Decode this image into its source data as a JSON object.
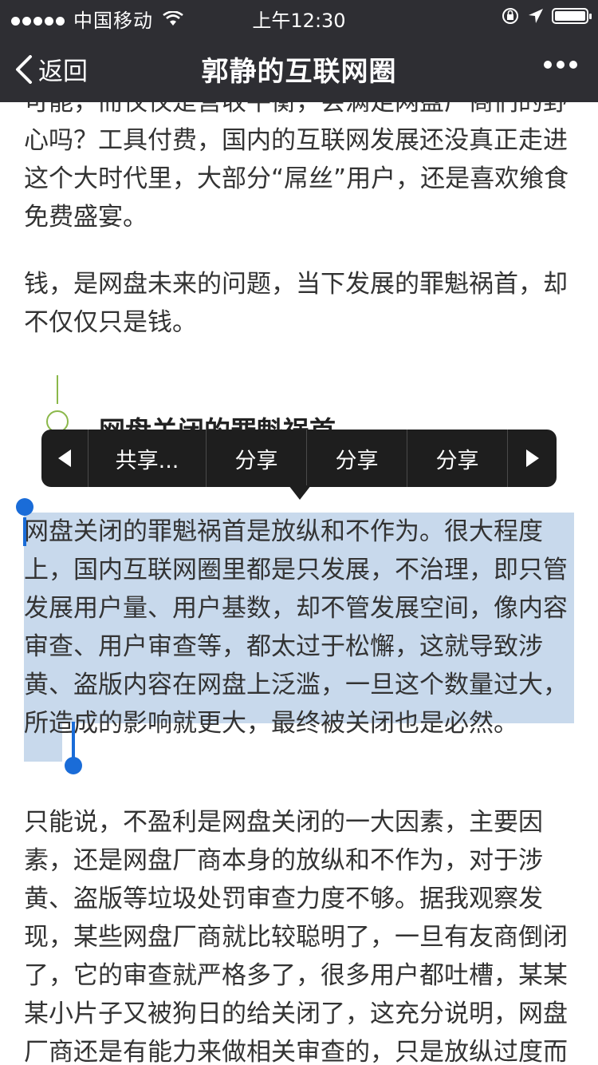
{
  "status_bar": {
    "carrier": "中国移动",
    "time": "上午12:30",
    "icons": [
      "signal-dots-icon",
      "wifi-icon",
      "rotation-lock-icon",
      "location-arrow-icon",
      "battery-icon"
    ]
  },
  "nav": {
    "back_label": "返回",
    "title": "郭静的互联网圈",
    "more_icon": "more-dots-icon"
  },
  "article": {
    "clipped_top": "可能，而仅仅是营收平衡，会满足网盘厂商们的野心吗？工具付费，国内的互联网发展还没真正走进这个大时代里，大部分“屌丝”用户，还是喜欢飨食免费盛宴。",
    "para_money": "钱，是网盘未来的问题，当下发展的罪魁祸首，却不仅仅只是钱。",
    "heading": "网盘关闭的罪魁祸首",
    "selected_para": "网盘关闭的罪魁祸首是放纵和不作为。很大程度上，国内互联网圈里都是只发展，不治理，即只管发展用户量、用户基数，却不管发展空间，像内容审查、用户审查等，都太过于松懈，这就导致涉黄、盗版内容在网盘上泛滥，一旦这个数量过大，所造成的影响就更大，最终被关闭也是必然。",
    "last_para": "只能说，不盈利是网盘关闭的一大因素，主要因素，还是网盘厂商本身的放纵和不作为，对于涉黄、盗版等垃圾处罚审查力度不够。据我观察发现，某些网盘厂商就比较聪明了，一旦有友商倒闭了，它的审查就严格多了，很多用户都吐槽，某某某小片子又被狗日的给关闭了，这充分说明，网盘厂商还是有能力来做相关审查的，只是放纵过度而已。若彻底做到技术屏蔽，那我定会"
  },
  "context_menu": {
    "items": [
      "共享...",
      "分享",
      "分享",
      "分享"
    ],
    "prev_icon": "arrow-left-icon",
    "next_icon": "arrow-right-icon"
  },
  "colors": {
    "bar_bg": "#2e2e33",
    "selection": "#c8d9ec",
    "handle": "#1a6cd8",
    "accent_green": "#8bb84a"
  }
}
